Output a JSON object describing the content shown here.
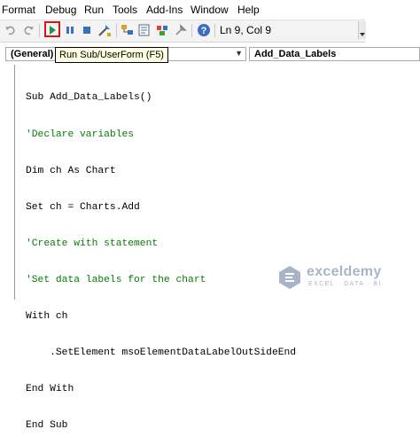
{
  "menu": {
    "items": [
      "Format",
      "Debug",
      "Run",
      "Tools",
      "Add-Ins",
      "Window",
      "Help"
    ]
  },
  "toolbar": {
    "buttons": [
      "undo-icon",
      "redo-icon",
      "run-icon",
      "break-icon",
      "reset-icon",
      "design-mode-icon",
      "project-explorer-icon",
      "properties-icon",
      "object-browser-icon",
      "toolbox-icon",
      "help-icon"
    ],
    "status": "Ln 9, Col 9"
  },
  "code_pane": {
    "object_dropdown": "(General)",
    "procedure_dropdown": "Add_Data_Labels"
  },
  "tooltip": "Run Sub/UserForm (F5)",
  "code": {
    "lines": [
      "Sub Add_Data_Labels()",
      "'Declare variables",
      "Dim ch As Chart",
      "Set ch = Charts.Add",
      "'Create with statement",
      "'Set data labels for the chart",
      "With ch",
      "    .SetElement msoElementDataLabelOutSideEnd",
      "End With",
      "End Sub"
    ]
  },
  "watermark": {
    "brand": "exceldemy",
    "tagline": "EXCEL · DATA · BI"
  },
  "colors": {
    "comment": "#0a7a0a",
    "run_highlight": "#d01818",
    "tooltip_bg": "#ffffe1"
  }
}
